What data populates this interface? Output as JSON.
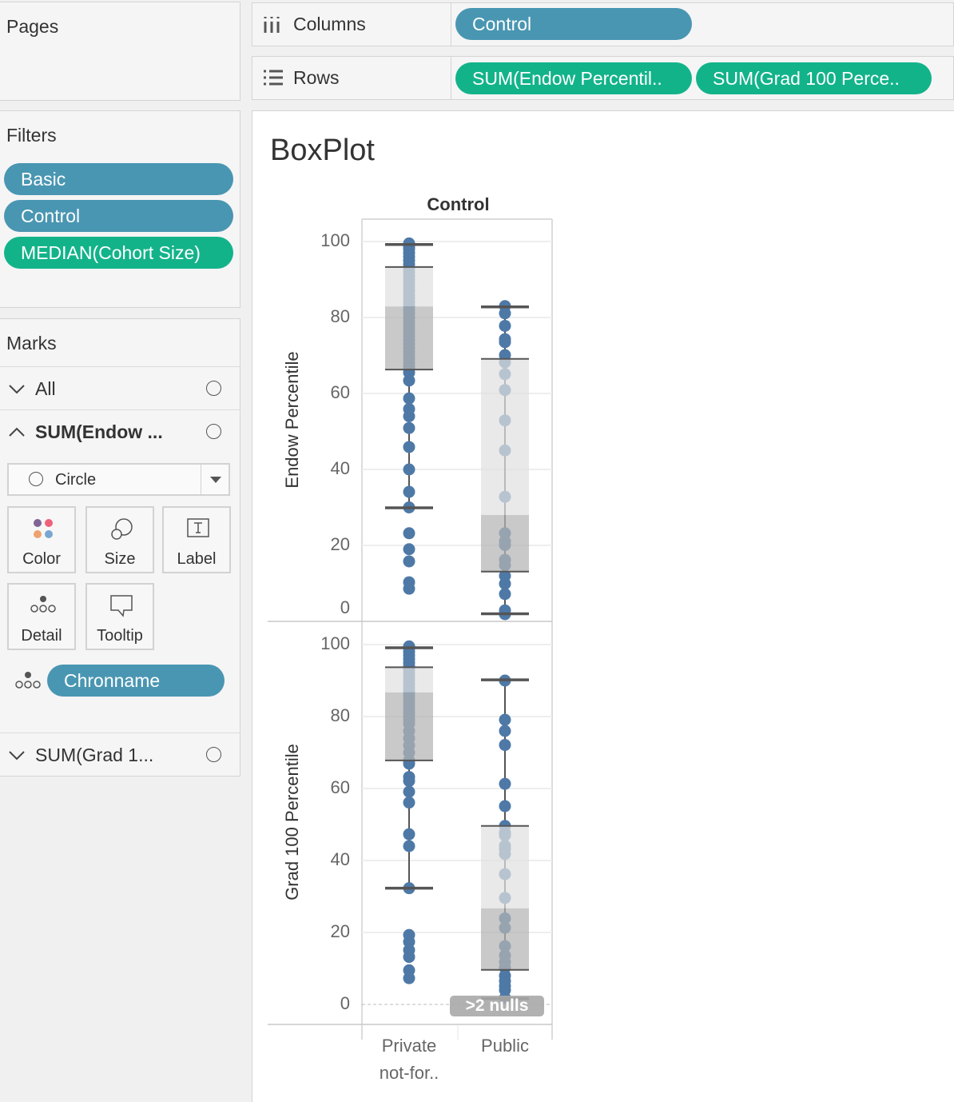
{
  "pages": {
    "title": "Pages"
  },
  "filters": {
    "title": "Filters",
    "items": [
      "Basic",
      "Control",
      "MEDIAN(Cohort Size)"
    ]
  },
  "marks": {
    "title": "Marks",
    "all_label": "All",
    "endow_label": "SUM(Endow ...",
    "grad_label": "SUM(Grad 1...",
    "mark_type": "Circle",
    "buttons": {
      "color": "Color",
      "size": "Size",
      "label": "Label",
      "detail": "Detail",
      "tooltip": "Tooltip"
    },
    "detail_pill": "Chronname"
  },
  "shelves": {
    "columns_label": "Columns",
    "rows_label": "Rows",
    "columns_pills": [
      "Control"
    ],
    "rows_pills": [
      "SUM(Endow Percentil..",
      "SUM(Grad 100 Perce.."
    ]
  },
  "colors": {
    "dimension": "#4996b2",
    "measure": "#13b38a",
    "mark": "#4e79a7"
  },
  "chart_data": {
    "type": "box-plot",
    "title": "BoxPlot",
    "column_header": "Control",
    "categories": [
      "Private not-for..",
      "Public"
    ],
    "panels": [
      {
        "ylabel": "Endow Percentile",
        "yticks": [
          "100",
          "80",
          "60",
          "40",
          "20",
          "0"
        ],
        "tick_values": [
          100,
          80,
          60,
          40,
          20,
          0
        ],
        "ylim": [
          -0.5,
          100
        ],
        "series": [
          {
            "category": "Private not-for..",
            "upper_whisker": 99.2,
            "q3": 93.3,
            "median": 82.9,
            "q1": 66.3,
            "lower_whisker": 29.9,
            "points": [
              99.5,
              99,
              98.5,
              98,
              97,
              96,
              95,
              94,
              93,
              92,
              91,
              90,
              89,
              88,
              87,
              86,
              85,
              84,
              83,
              82,
              81,
              80,
              79,
              78,
              77,
              76,
              75,
              74,
              73,
              72,
              71,
              70,
              69,
              68,
              67,
              66.5,
              65.5,
              63.4,
              58.7,
              55.9,
              54,
              50.9,
              45.9,
              40,
              34.1,
              30,
              23.2,
              19,
              15.8,
              10.3,
              8.6
            ]
          },
          {
            "category": "Public",
            "upper_whisker": 82.8,
            "q3": 69.1,
            "median": 28,
            "q1": 13.1,
            "lower_whisker": 2,
            "points": [
              83,
              81.1,
              77.8,
              74.3,
              73.5,
              70.1,
              68.2,
              65.1,
              60.9,
              52.9,
              45,
              32.8,
              23.2,
              21.1,
              20.1,
              16.2,
              14.8,
              12,
              9.9,
              7.2,
              2.9,
              1.9
            ]
          }
        ]
      },
      {
        "ylabel": "Grad 100 Percentile",
        "yticks": [
          "100",
          "80",
          "60",
          "40",
          "20",
          "0"
        ],
        "tick_values": [
          100,
          80,
          60,
          40,
          20,
          0
        ],
        "ylim": [
          -5,
          100
        ],
        "null_badge": ">2 nulls",
        "series": [
          {
            "category": "Private not-for..",
            "upper_whisker": 99.1,
            "q3": 93.7,
            "median": 86.7,
            "q1": 67.8,
            "lower_whisker": 32.3,
            "points": [
              99.5,
              99,
              98,
              97,
              96,
              95,
              94,
              93,
              92,
              91,
              90,
              89,
              88,
              87,
              86,
              85,
              84,
              83,
              82,
              81,
              80,
              79,
              78,
              76,
              74,
              72,
              70,
              67.8,
              66.9,
              63.2,
              62.1,
              59.1,
              56.1,
              47.3,
              44,
              32.3,
              19.3,
              17.4,
              15.1,
              13.2,
              9.5,
              7.3
            ]
          },
          {
            "category": "Public",
            "upper_whisker": 90.2,
            "q3": 49.6,
            "median": 26.7,
            "q1": 9.6,
            "lower_whisker": 1.6,
            "points": [
              90,
              79.1,
              76,
              72.1,
              61.3,
              55.1,
              49.6,
              47.7,
              47,
              44.1,
              43.2,
              41.8,
              36.2,
              29.6,
              23.9,
              21.3,
              16.2,
              13.6,
              11.8,
              10.2,
              8,
              6.5,
              5.1,
              4,
              1.8
            ]
          }
        ]
      }
    ]
  }
}
